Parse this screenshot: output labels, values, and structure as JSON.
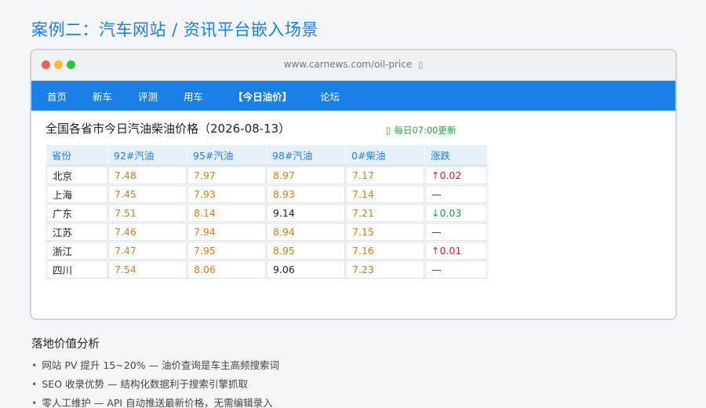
{
  "page_heading": "案例二：汽车网站 / 资讯平台嵌入场景",
  "browser": {
    "url": "www.carnews.com/oil-price",
    "lock_icon": "lock-icon"
  },
  "nav": {
    "items": [
      {
        "label": "首页"
      },
      {
        "label": "新车"
      },
      {
        "label": "评测"
      },
      {
        "label": "用车"
      },
      {
        "label": "【今日油价】"
      },
      {
        "label": "论坛"
      }
    ],
    "active_index": 4
  },
  "table_title": "全国各省市今日汽油柴油价格（2026-08-13）",
  "update_note": "每日07:00更新",
  "table": {
    "headers": [
      "省份",
      "92#汽油",
      "95#汽油",
      "98#汽油",
      "0#柴油",
      "涨跌"
    ],
    "rows": [
      {
        "province": "北京",
        "p92": "7.48",
        "p95": "7.97",
        "p98": "8.97",
        "p0": "7.17",
        "change": "↑0.02",
        "trend": "up"
      },
      {
        "province": "上海",
        "p92": "7.45",
        "p95": "7.93",
        "p98": "8.93",
        "p0": "7.14",
        "change": "—",
        "trend": "flat"
      },
      {
        "province": "广东",
        "p92": "7.51",
        "p95": "8.14",
        "p98": "9.14",
        "p0": "7.21",
        "change": "↓0.03",
        "trend": "down"
      },
      {
        "province": "江苏",
        "p92": "7.46",
        "p95": "7.94",
        "p98": "8.94",
        "p0": "7.15",
        "change": "—",
        "trend": "flat"
      },
      {
        "province": "浙江",
        "p92": "7.47",
        "p95": "7.95",
        "p98": "8.95",
        "p0": "7.16",
        "change": "↑0.01",
        "trend": "up"
      },
      {
        "province": "四川",
        "p92": "7.54",
        "p95": "8.06",
        "p98": "9.06",
        "p0": "7.23",
        "change": "—",
        "trend": "flat"
      }
    ]
  },
  "analysis": {
    "title": "落地价值分析",
    "items": [
      "网站 PV 提升 15~20% — 油价查询是车主高频搜索词",
      "SEO 收录优势 — 结构化数据利于搜索引擎抓取",
      "零人工维护 — API 自动推送最新价格，无需编辑录入"
    ]
  },
  "colors": {
    "accent": "#1a7fe6",
    "price": "#e07a10",
    "up": "#d2232a",
    "down": "#18a33a"
  }
}
